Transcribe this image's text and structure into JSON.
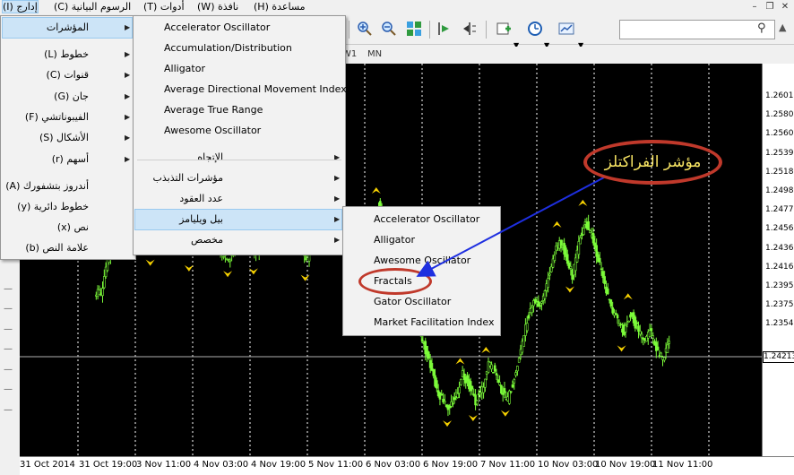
{
  "menubar": {
    "items": [
      "إدارج (I)",
      "الرسوم البيانية (C)",
      "أدوات (T)",
      "نافذة (W)",
      "مساعدة (H)"
    ]
  },
  "menu_insert": {
    "items": [
      {
        "label": "المؤشرات",
        "submenu": true,
        "selected": true
      },
      {
        "label": "خطوط (L)",
        "submenu": true
      },
      {
        "label": "قنوات (C)",
        "submenu": true
      },
      {
        "label": "جان (G)",
        "submenu": true
      },
      {
        "label": "الفيبوناتشي (F)",
        "submenu": true
      },
      {
        "label": "الأشكال (S)",
        "submenu": true
      },
      {
        "label": "أسهم (r)",
        "submenu": true
      },
      {
        "label": "أندروز بتشفورك (A)",
        "submenu": false
      },
      {
        "label": "خطوط دائرية (y)",
        "submenu": false
      },
      {
        "label": "نص (x)",
        "submenu": false
      },
      {
        "label": "علامة النص (b)",
        "submenu": false
      }
    ]
  },
  "menu_indicators": {
    "items": [
      {
        "label": "Accelerator Oscillator"
      },
      {
        "label": "Accumulation/Distribution"
      },
      {
        "label": "Alligator"
      },
      {
        "label": "Average Directional Movement Index"
      },
      {
        "label": "Average True Range"
      },
      {
        "label": "Awesome Oscillator"
      }
    ],
    "groups": [
      {
        "label": "الإتجاه",
        "submenu": true
      },
      {
        "label": "مؤشرات التذبذب",
        "submenu": true
      },
      {
        "label": "عدد العقود",
        "submenu": true
      },
      {
        "label": "بيل ويليامز",
        "submenu": true,
        "selected": true
      },
      {
        "label": "مخصص",
        "submenu": true
      }
    ]
  },
  "menu_billwilliams": {
    "items": [
      {
        "label": "Accelerator Oscillator"
      },
      {
        "label": "Alligator"
      },
      {
        "label": "Awesome Oscillator"
      },
      {
        "label": "Fractals"
      },
      {
        "label": "Gator Oscillator"
      },
      {
        "label": "Market Facilitation Index"
      }
    ]
  },
  "timeframes": [
    "W1",
    "MN"
  ],
  "annotation": {
    "text": "مؤشر الفراكتلز"
  },
  "price_axis": {
    "labels": [
      "1.26010",
      "1.25800",
      "1.25600",
      "1.25390",
      "1.25180",
      "1.24980",
      "1.24770",
      "1.24560",
      "1.24360",
      "1.24160",
      "1.23950",
      "1.23750",
      "1.23540"
    ],
    "current": "1.24213"
  },
  "time_axis": {
    "labels": [
      "31 Oct 2014",
      "31 Oct 19:00",
      "3 Nov 11:00",
      "4 Nov 03:00",
      "4 Nov 19:00",
      "5 Nov 11:00",
      "6 Nov 03:00",
      "6 Nov 19:00",
      "7 Nov 11:00",
      "10 Nov 03:00",
      "10 Nov 19:00",
      "11 Nov 11:00"
    ]
  },
  "colors": {
    "candle": "#7cfc3a",
    "fractal": "#f5d000",
    "background": "#000000",
    "annotation": "#c0392b",
    "arrow": "#1e2fe0"
  },
  "chart_data": {
    "type": "candlestick",
    "series": [
      {
        "values": [
          1.2455,
          1.2478,
          1.2492,
          1.2485,
          1.2498,
          1.2505,
          1.2501,
          1.2492,
          1.2488,
          1.2497,
          1.2509,
          1.2515,
          1.2506,
          1.2493,
          1.2486,
          1.2497,
          1.2501,
          1.2494,
          1.2488,
          1.2481,
          1.2478,
          1.2489,
          1.2497,
          1.2491,
          1.2483,
          1.2487,
          1.2495,
          1.2503,
          1.2507,
          1.2498,
          1.2491,
          1.2484,
          1.2479,
          1.2491,
          1.2502,
          1.2507,
          1.2499,
          1.2489,
          1.2475,
          1.2469,
          1.2477,
          1.2494,
          1.2506,
          1.2515,
          1.2504,
          1.2493,
          1.2486,
          1.2471,
          1.2454,
          1.2438,
          1.2419,
          1.2405,
          1.2388,
          1.2382,
          1.2376,
          1.2385,
          1.2399,
          1.2392,
          1.2381,
          1.2388,
          1.2406,
          1.2401,
          1.2388,
          1.2382,
          1.2397,
          1.2415,
          1.2437,
          1.2451,
          1.2446,
          1.2461,
          1.2478,
          1.2491,
          1.2481,
          1.2467,
          1.2489,
          1.2505,
          1.2493,
          1.2478,
          1.2461,
          1.2444,
          1.2435,
          1.2429,
          1.2441,
          1.2431,
          1.2422,
          1.2429,
          1.2417,
          1.2409,
          1.2423
        ]
      }
    ],
    "ylim": [
      1.2343,
      1.2612
    ]
  }
}
